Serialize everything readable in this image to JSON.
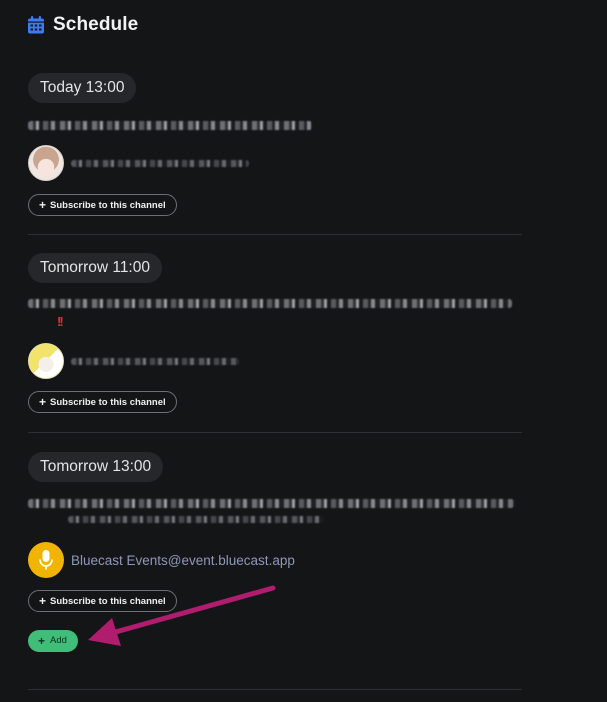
{
  "header": {
    "title": "Schedule",
    "icon": "calendar-icon",
    "icon_color": "#3d7bf2"
  },
  "events": [
    {
      "time_label": "Today 13:00",
      "author_name": "",
      "avatar": "anime-girl-avatar",
      "subscribe_label": "Subscribe to this channel"
    },
    {
      "time_label": "Tomorrow 11:00",
      "alert_mark": "!!",
      "author_name": "",
      "avatar": "anime-girl-play-avatar",
      "subscribe_label": "Subscribe to this channel"
    },
    {
      "time_label": "Tomorrow 13:00",
      "author_name": "Bluecast Events@event.bluecast.app",
      "avatar": "microphone-avatar",
      "avatar_color": "#f1b400",
      "subscribe_label": "Subscribe to this channel"
    }
  ],
  "add_button": {
    "label": "Add",
    "color": "#3fbd79"
  },
  "annotation": {
    "arrow_color": "#b01c6e"
  }
}
